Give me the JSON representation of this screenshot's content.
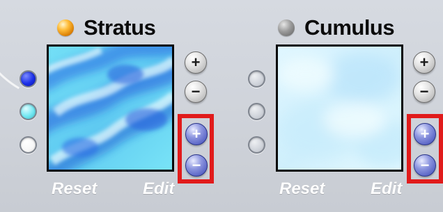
{
  "panels": [
    {
      "title": "Stratus",
      "status_led": "on",
      "swatches": [
        "#1b2fe8",
        "#72e8f2",
        "#ffffff"
      ],
      "controls": {
        "zoom_in": "+",
        "zoom_out": "−",
        "blue_zoom_in": "+",
        "blue_zoom_out": "−"
      },
      "footer": {
        "reset": "Reset",
        "edit": "Edit"
      }
    },
    {
      "title": "Cumulus",
      "status_led": "off",
      "swatches": [
        "empty",
        "empty",
        "empty"
      ],
      "controls": {
        "zoom_in": "+",
        "zoom_out": "−",
        "blue_zoom_in": "+",
        "blue_zoom_out": "−"
      },
      "footer": {
        "reset": "Reset",
        "edit": "Edit"
      }
    }
  ],
  "colors": {
    "panel_bg": "#cfd3da",
    "highlight_box": "#e11b1b",
    "led_on": "#ffbd3a",
    "led_off": "#8b8b8b",
    "blue_button": "#3b47b6"
  },
  "icons": {
    "led": "status-led-icon",
    "plus": "plus-icon",
    "minus": "minus-icon"
  }
}
